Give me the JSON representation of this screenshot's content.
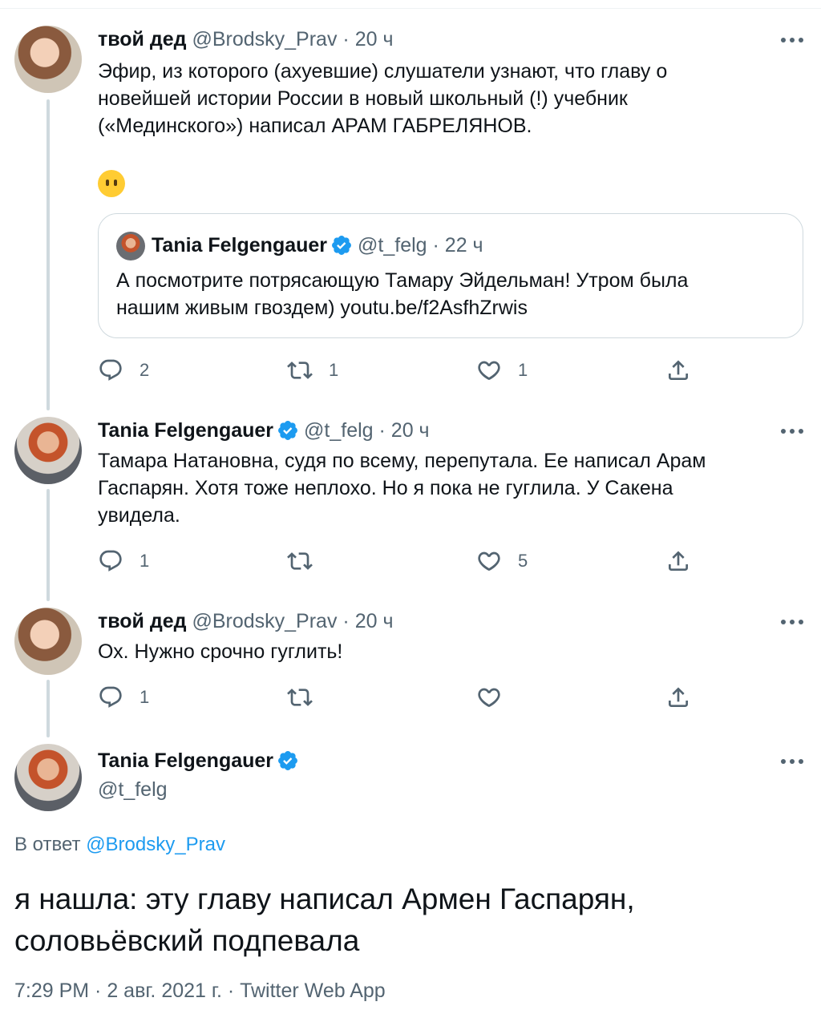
{
  "tweets": [
    {
      "name": "твой дед",
      "handle": "@Brodsky_Prav",
      "time": "· 20 ч",
      "text_lines": [
        "Эфир, из которого (ахуевшие) слушатели узнают, что главу о",
        "новейшей истории России в новый школьный (!) учебник",
        "(«Мединского») написал АРАМ ГАБРЕЛЯНОВ."
      ],
      "emoji": "😶",
      "quote": {
        "name": "Tania Felgengauer",
        "handle": "@t_felg",
        "time": "· 22 ч",
        "text_lines": [
          "А посмотрите потрясающую Тамару Эйдельман! Утром была",
          "нашим живым гвоздем) youtu.be/f2AsfhZrwis"
        ]
      },
      "replies": "2",
      "retweets": "1",
      "likes": "1"
    },
    {
      "name": "Tania Felgengauer",
      "handle": "@t_felg",
      "time": "· 20 ч",
      "text_lines": [
        "Тамара Натановна, судя по всему, перепутала. Ее написал Арам",
        "Гаспарян. Хотя тоже неплохо. Но я пока не гуглила. У Сакена",
        "увидела."
      ],
      "replies": "1",
      "retweets": "",
      "likes": "5"
    },
    {
      "name": "твой дед",
      "handle": "@Brodsky_Prav",
      "time": "· 20 ч",
      "text_lines": [
        "Ох. Нужно срочно гуглить!"
      ],
      "replies": "1",
      "retweets": "",
      "likes": ""
    }
  ],
  "main_tweet": {
    "name": "Tania Felgengauer",
    "handle": "@t_felg",
    "reply_prefix": "В ответ",
    "reply_to": "@Brodsky_Prav",
    "text_lines": [
      "я нашла: эту главу написал Армен Гаспарян,",
      "соловьёвский подпевала"
    ],
    "footer": "7:29 PM · 2 авг. 2021 г. · Twitter Web App"
  },
  "colors": {
    "verified": "#1d9bf0",
    "link": "#1d9bf0",
    "secondary_text": "#536471",
    "thread_line": "#cfd9de"
  },
  "icons": [
    "reply-icon",
    "retweet-icon",
    "like-icon",
    "share-icon",
    "more-icon",
    "verified-badge-icon"
  ]
}
